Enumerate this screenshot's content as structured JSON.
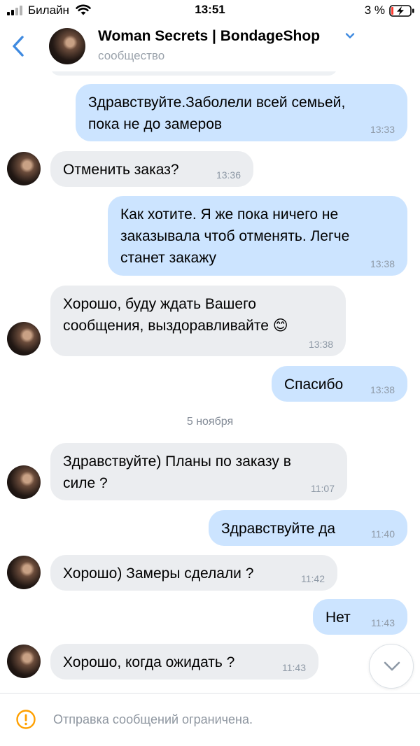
{
  "status_bar": {
    "carrier": "Билайн",
    "time": "13:51",
    "battery_percent": "3 %"
  },
  "header": {
    "title": "Woman Secrets | BondageShop",
    "subtitle": "сообщество",
    "icons": [
      "chevron-left-icon",
      "chevron-down-icon"
    ]
  },
  "messages": [
    {
      "direction": "outgoing",
      "text_lines": [
        "Здравствуйте.Заболели всей семьей,",
        "пока не до замеров"
      ],
      "time": "13:33"
    },
    {
      "direction": "incoming",
      "text_lines": [
        "Отменить заказ?"
      ],
      "time": "13:36"
    },
    {
      "direction": "outgoing",
      "text_lines": [
        "Как хотите. Я же пока ничего не",
        "заказывала чтоб отменять. Легче",
        "станет закажу"
      ],
      "time": "13:38"
    },
    {
      "direction": "incoming",
      "text_lines": [
        "Хорошо, буду ждать Вашего",
        "сообщения, выздоравливайте 😊"
      ],
      "time": "13:38"
    },
    {
      "direction": "outgoing",
      "text_lines": [
        "Спасибо"
      ],
      "time": "13:38"
    },
    {
      "direction": "incoming",
      "text_lines": [
        "Здравствуйте) Планы по заказу в",
        "силе ?"
      ],
      "time": "11:07"
    },
    {
      "direction": "outgoing",
      "text_lines": [
        "Здравствуйте да"
      ],
      "time": "11:40"
    },
    {
      "direction": "incoming",
      "text_lines": [
        "Хорошо) Замеры сделали ?"
      ],
      "time": "11:42"
    },
    {
      "direction": "outgoing",
      "text_lines": [
        "Нет"
      ],
      "time": "11:43"
    },
    {
      "direction": "incoming",
      "text_lines": [
        "Хорошо, когда ожидать ?"
      ],
      "time": "11:43"
    }
  ],
  "date_separator": "5 ноября",
  "bottom_bar": {
    "notice": "Отправка сообщений ограничена.",
    "icon": "exclamation-circle-icon"
  },
  "colors": {
    "accent": "#3f8ae0",
    "outgoing_bubble": "#cce4ff",
    "incoming_bubble": "#ebedf0",
    "warning": "#ffa000"
  }
}
